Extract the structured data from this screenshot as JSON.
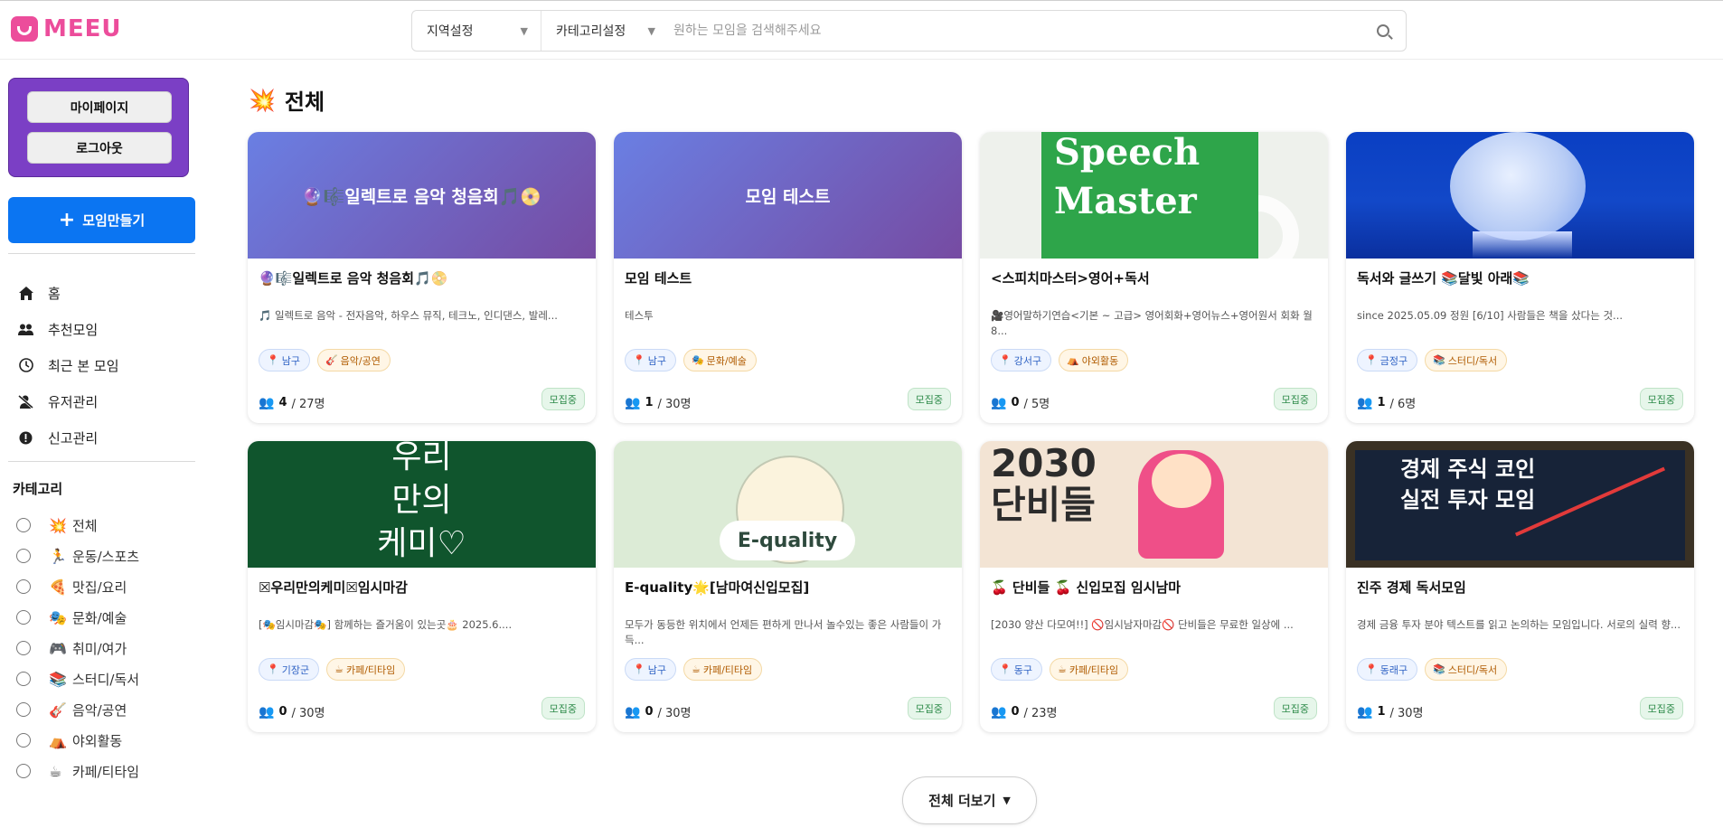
{
  "header": {
    "logo_text": "MEEU",
    "region_select": "지역설정",
    "category_select": "카테고리설정",
    "search_placeholder": "원하는 모임을 검색해주세요"
  },
  "sidebar": {
    "mypage_label": "마이페이지",
    "logout_label": "로그아웃",
    "create_label": "모임만들기",
    "nav": [
      {
        "label": "홈",
        "icon": "home-icon"
      },
      {
        "label": "추천모임",
        "icon": "people-icon"
      },
      {
        "label": "최근 본 모임",
        "icon": "clock-icon"
      },
      {
        "label": "유저관리",
        "icon": "user-slash-icon"
      },
      {
        "label": "신고관리",
        "icon": "alert-icon"
      }
    ],
    "category_title": "카테고리",
    "categories": [
      {
        "label": "전체",
        "emoji": "💥"
      },
      {
        "label": "운동/스포츠",
        "emoji": "🏃"
      },
      {
        "label": "맛집/요리",
        "emoji": "🍕"
      },
      {
        "label": "문화/예술",
        "emoji": "🎭"
      },
      {
        "label": "취미/여가",
        "emoji": "🎮"
      },
      {
        "label": "스터디/독서",
        "emoji": "📚"
      },
      {
        "label": "음악/공연",
        "emoji": "🎸"
      },
      {
        "label": "야외활동",
        "emoji": "⛺"
      },
      {
        "label": "카페/티타임",
        "emoji": "☕"
      }
    ]
  },
  "main": {
    "title_emoji": "💥",
    "title": "전체",
    "more_label": "전체 더보기",
    "cards": [
      {
        "thumb_text": "🔮🎼일렉트로 음악 청음회🎵📀",
        "title": "🔮🎼일렉트로 음악 청음회🎵📀",
        "desc": "🎵 일렉트로 음악 - 전자음악, 하우스 뮤직, 테크노, 인디댄스, 발레...",
        "region": "남구",
        "category": "음악/공연",
        "category_emoji": "🎸",
        "count": "4",
        "capacity": "/ 27명",
        "status": "모집중"
      },
      {
        "thumb_text": "모임 테스트",
        "title": "모임 테스트",
        "desc": "테스투",
        "region": "남구",
        "category": "문화/예술",
        "category_emoji": "🎭",
        "count": "1",
        "capacity": "/ 30명",
        "status": "모집중"
      },
      {
        "thumb_text": "Speech\nMaster",
        "title": "<스피치마스터>영어+독서",
        "desc": "🎥영어말하기연습<기본 ~ 고급> 영어회화+영어뉴스+영어원서 회화 월8...",
        "region": "강서구",
        "category": "야외활동",
        "category_emoji": "⛺",
        "count": "0",
        "capacity": "/ 5명",
        "status": "모집중"
      },
      {
        "thumb_text": "",
        "title": "독서와 글쓰기 📚달빛 아래📚",
        "desc": "since 2025.05.09 정원 [6/10] 사람들은 책을 샀다는 것...",
        "region": "금정구",
        "category": "스터디/독서",
        "category_emoji": "📚",
        "count": "1",
        "capacity": "/ 6명",
        "status": "모집중"
      },
      {
        "thumb_text": "우리\n만의\n케미♡",
        "title": "☒우리만의케미☒임시마감",
        "desc": "[🎭임시마감🎭] 함께하는 즐거움이 있는곳🎂 2025.6....",
        "region": "기장군",
        "category": "카페/티타임",
        "category_emoji": "☕",
        "count": "0",
        "capacity": "/ 30명",
        "status": "모집중"
      },
      {
        "thumb_text": "E-quality",
        "title": "E-quality🌟[남마여신입모집]",
        "desc": "모두가 동등한 위치에서 언제든 편하게 만나서 놀수있는 좋은 사람들이 가득...",
        "region": "남구",
        "category": "카페/티타임",
        "category_emoji": "☕",
        "count": "0",
        "capacity": "/ 30명",
        "status": "모집중"
      },
      {
        "thumb_text": "2030\n단비들",
        "title": "🍒 단비들 🍒 신입모집 임시남마",
        "desc": "[2030 양산 다모여!!] 🚫임시남자마감🚫 단비들은 무료한 일상에 ...",
        "region": "동구",
        "category": "카페/티타임",
        "category_emoji": "☕",
        "count": "0",
        "capacity": "/ 23명",
        "status": "모집중"
      },
      {
        "thumb_text": "경제 주식 코인\n실전 투자 모임",
        "title": "진주 경제 독서모임",
        "desc": "경제 금융 투자 분야 텍스트를 읽고 논의하는 모임입니다. 서로의 실력 향...",
        "region": "동래구",
        "category": "스터디/독서",
        "category_emoji": "📚",
        "count": "1",
        "capacity": "/ 30명",
        "status": "모집중"
      }
    ]
  },
  "colors": {
    "brand": "#ec4d9b",
    "primary_button": "#0b75f2",
    "profile_box": "#7b3fc5",
    "status_green": "#2e8b4a"
  }
}
